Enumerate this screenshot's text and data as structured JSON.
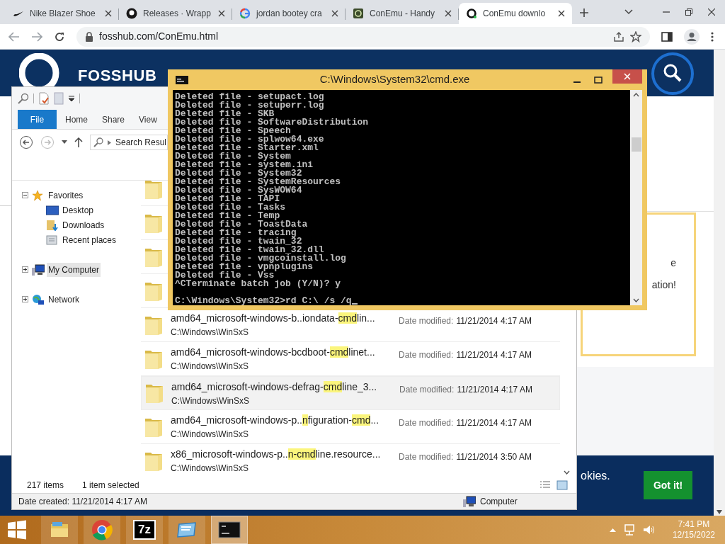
{
  "browser": {
    "tabs": [
      {
        "title": "Nike Blazer Shoe",
        "kind": "swoosh",
        "selected": false
      },
      {
        "title": "Releases · Wrapp",
        "kind": "github",
        "selected": false
      },
      {
        "title": "jordan bootey cra",
        "kind": "google",
        "selected": false
      },
      {
        "title": "ConEmu - Handy",
        "kind": "conemu",
        "selected": false
      },
      {
        "title": "ConEmu downlo",
        "kind": "ring",
        "selected": true
      }
    ],
    "url": "fosshub.com/ConEmu.html"
  },
  "web": {
    "logo": "FOSSHUB",
    "box_lines": [
      "e",
      "ation!"
    ],
    "cookie_text": "okies.",
    "cookie_button": "Got it!"
  },
  "explorer": {
    "ribbon_tabs": [
      {
        "label": "File",
        "selected": true
      },
      {
        "label": "Home",
        "selected": false
      },
      {
        "label": "Share",
        "selected": false
      },
      {
        "label": "View",
        "selected": false
      }
    ],
    "address": "Search Resul",
    "nav": [
      {
        "label": "Favorites",
        "kind": "star",
        "expanded": true,
        "selected": false,
        "children": [
          {
            "label": "Desktop",
            "kind": "desktop",
            "selected": false
          },
          {
            "label": "Downloads",
            "kind": "downloads",
            "selected": false
          },
          {
            "label": "Recent places",
            "kind": "recent",
            "selected": false
          }
        ]
      },
      {
        "label": "My Computer",
        "kind": "computer",
        "expanded": false,
        "selected": true
      },
      {
        "label": "Network",
        "kind": "network",
        "expanded": false,
        "selected": false
      }
    ],
    "files": [
      {
        "kind": "covered"
      },
      {
        "kind": "covered"
      },
      {
        "kind": "covered"
      },
      {
        "kind": "covered"
      },
      {
        "kind": "file",
        "selected": false,
        "name_parts": [
          {
            "text": "amd64_microsoft-windows-b..iondata-",
            "highlight": false
          },
          {
            "text": "cmd",
            "highlight": true
          },
          {
            "text": "lin...",
            "highlight": false
          }
        ],
        "path": "C:\\Windows\\WinSxS",
        "date_label": "Date modified:",
        "date": "11/21/2014 4:17 AM"
      },
      {
        "kind": "file",
        "selected": false,
        "name_parts": [
          {
            "text": "amd64_microsoft-windows-bcdboot-",
            "highlight": false
          },
          {
            "text": "cmd",
            "highlight": true
          },
          {
            "text": "linet...",
            "highlight": false
          }
        ],
        "path": "C:\\Windows\\WinSxS",
        "date_label": "Date modified:",
        "date": "11/21/2014 4:17 AM"
      },
      {
        "kind": "file",
        "selected": true,
        "name_parts": [
          {
            "text": "amd64_microsoft-windows-defrag-",
            "highlight": false
          },
          {
            "text": "cmd",
            "highlight": true
          },
          {
            "text": "line_3...",
            "highlight": false
          }
        ],
        "path": "C:\\Windows\\WinSxS",
        "date_label": "Date modified:",
        "date": "11/21/2014 4:17 AM"
      },
      {
        "kind": "file",
        "selected": false,
        "name_parts": [
          {
            "text": "amd64_microsoft-windows-p..",
            "highlight": false
          },
          {
            "text": "n",
            "highlight": true
          },
          {
            "text": "figuration-",
            "highlight": false
          },
          {
            "text": "cmd",
            "highlight": true
          },
          {
            "text": "...",
            "highlight": false
          }
        ],
        "path": "C:\\Windows\\WinSxS",
        "date_label": "Date modified:",
        "date": "11/21/2014 4:17 AM"
      },
      {
        "kind": "file",
        "selected": false,
        "name_parts": [
          {
            "text": "x86_microsoft-windows-p..",
            "highlight": false
          },
          {
            "text": "n-cmd",
            "highlight": true
          },
          {
            "text": "line.resource...",
            "highlight": false
          }
        ],
        "path": "C:\\Windows\\WinSxS",
        "date_label": "Date modified:",
        "date": "11/21/2014 3:50 AM"
      }
    ],
    "item_count": "217 items",
    "selection": "1 item selected",
    "details": "Date created: 11/21/2014 4:17 AM",
    "location": "Computer"
  },
  "console": {
    "title": "C:\\Windows\\System32\\cmd.exe",
    "lines": [
      "Deleted file - setupact.log",
      "Deleted file - setuperr.log",
      "Deleted file - SKB",
      "Deleted file - SoftwareDistribution",
      "Deleted file - Speech",
      "Deleted file - splwow64.exe",
      "Deleted file - Starter.xml",
      "Deleted file - System",
      "Deleted file - system.ini",
      "Deleted file - System32",
      "Deleted file - SystemResources",
      "Deleted file - SysWOW64",
      "Deleted file - TAPI",
      "Deleted file - Tasks",
      "Deleted file - Temp",
      "Deleted file - ToastData",
      "Deleted file - tracing",
      "Deleted file - twain_32",
      "Deleted file - twain_32.dll",
      "Deleted file - vmgcoinstall.log",
      "Deleted file - vpnplugins",
      "Deleted file - Vss",
      "^CTerminate batch job (Y/N)? y"
    ],
    "prompt": "C:\\Windows\\System32>rd C:\\ /s /q"
  },
  "taskbar": {
    "apps": [
      {
        "kind": "explorer",
        "selected": false
      },
      {
        "kind": "chrome",
        "selected": false
      },
      {
        "kind": "sevenzip",
        "label": "7z",
        "selected": false
      },
      {
        "kind": "remote",
        "selected": false
      },
      {
        "kind": "console",
        "selected": true
      }
    ],
    "time": "7:41 PM",
    "date": "12/15/2022"
  }
}
